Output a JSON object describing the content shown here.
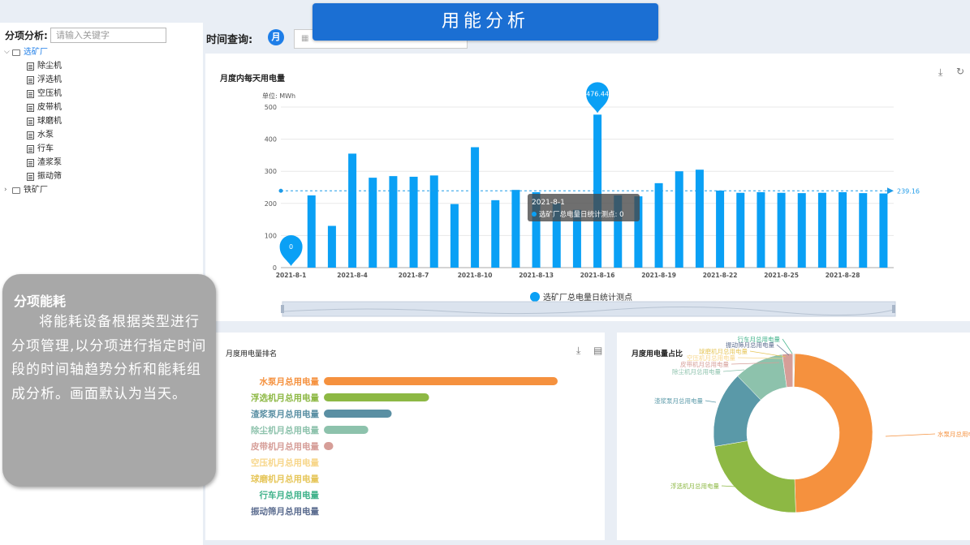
{
  "banner_title": "用能分析",
  "sidebar": {
    "heading": "分项分析:",
    "search_placeholder": "请输入关键字",
    "tree": [
      {
        "label": "选矿厂",
        "expanded": true,
        "selected": true,
        "children": [
          "除尘机",
          "浮选机",
          "空压机",
          "皮带机",
          "球磨机",
          "水泵",
          "行车",
          "渣浆泵",
          "振动筛"
        ]
      },
      {
        "label": "铁矿厂",
        "expanded": false,
        "children": []
      }
    ]
  },
  "toolbar": {
    "label": "时间查询:",
    "month_button": "月"
  },
  "top_chart": {
    "title": "月度内每天用电量",
    "unit_label": "单位: MWh",
    "legend": "选矿厂总电量日统计测点",
    "tooltip_title": "2021-8-1",
    "tooltip_value": "选矿厂总电量日统计测点: 0",
    "max_label": "476.44",
    "min_label": "0",
    "avg_label": "239.16",
    "icons": [
      "download-icon",
      "refresh-icon"
    ]
  },
  "bottom_left": {
    "title": "月度用电量排名",
    "icons": [
      "download-icon",
      "document-icon"
    ]
  },
  "bottom_right": {
    "title": "月度用电量占比"
  },
  "overlay": {
    "title": "分项能耗",
    "text": "将能耗设备根据类型进行分项管理,以分项进行指定时间段的时间轴趋势分析和能耗组成分析。画面默认为当天。"
  },
  "chart_data": [
    {
      "type": "bar",
      "title": "月度内每天用电量",
      "ylabel": "单位: MWh",
      "ylim": [
        0,
        500
      ],
      "yticks": [
        0,
        100,
        200,
        300,
        400,
        500
      ],
      "x_tick_labels": [
        "2021-8-1",
        "2021-8-4",
        "2021-8-7",
        "2021-8-10",
        "2021-8-13",
        "2021-8-16",
        "2021-8-19",
        "2021-8-22",
        "2021-8-25",
        "2021-8-28"
      ],
      "categories": [
        "2021-8-1",
        "2021-8-2",
        "2021-8-3",
        "2021-8-4",
        "2021-8-5",
        "2021-8-6",
        "2021-8-7",
        "2021-8-8",
        "2021-8-9",
        "2021-8-10",
        "2021-8-11",
        "2021-8-12",
        "2021-8-13",
        "2021-8-14",
        "2021-8-15",
        "2021-8-16",
        "2021-8-17",
        "2021-8-18",
        "2021-8-19",
        "2021-8-20",
        "2021-8-21",
        "2021-8-22",
        "2021-8-23",
        "2021-8-24",
        "2021-8-25",
        "2021-8-26",
        "2021-8-27",
        "2021-8-28",
        "2021-8-29",
        "2021-8-30"
      ],
      "series": [
        {
          "name": "选矿厂总电量日统计测点",
          "values": [
            0,
            225,
            130,
            355,
            280,
            285,
            283,
            287,
            198,
            375,
            210,
            242,
            235,
            200,
            180,
            476.44,
            225,
            222,
            263,
            300,
            305,
            240,
            233,
            235,
            233,
            232,
            233,
            235,
            232,
            231
          ]
        }
      ],
      "mark_line_average": 239.16,
      "color": "#0aa0f5",
      "grid": true,
      "legend_position": "bottom"
    },
    {
      "type": "bar",
      "orientation": "horizontal",
      "title": "月度用电量排名",
      "categories": [
        "水泵月总用电量",
        "浮选机月总用电量",
        "渣浆泵月总用电量",
        "除尘机月总用电量",
        "皮带机月总用电量",
        "空压机月总用电量",
        "球磨机月总用电量",
        "行车月总用电量",
        "振动筛月总用电量"
      ],
      "values": [
        100,
        45,
        29,
        19,
        4,
        0,
        0,
        0,
        0
      ],
      "colors": [
        "#f5913e",
        "#8db844",
        "#5a8fa3",
        "#8dc2ac",
        "#d69e98",
        "#f7d68a",
        "#e6c65a",
        "#3fb28a",
        "#5b6c8f"
      ]
    },
    {
      "type": "pie",
      "title": "月度用电量占比",
      "donut": true,
      "slices": [
        {
          "label": "水泵月总用电量",
          "value": 46.5,
          "color": "#f5913e"
        },
        {
          "label": "浮选机月总用电量",
          "value": 21.5,
          "color": "#8db844"
        },
        {
          "label": "渣浆泵月总用电量",
          "value": 14.5,
          "color": "#5a99a8"
        },
        {
          "label": "除尘机月总用电量",
          "value": 9.5,
          "color": "#8dc2ac"
        },
        {
          "label": "皮带机月总用电量",
          "value": 2.0,
          "color": "#d69e98"
        },
        {
          "label": "空压机月总用电量",
          "value": 0.01,
          "color": "#f7d68a"
        },
        {
          "label": "球磨机月总用电量",
          "value": 0.01,
          "color": "#e6c65a"
        },
        {
          "label": "振动筛月总用电量",
          "value": 0.01,
          "color": "#5b6c8f"
        },
        {
          "label": "行车月总用电量",
          "value": 0.01,
          "color": "#3fb28a"
        }
      ]
    }
  ]
}
